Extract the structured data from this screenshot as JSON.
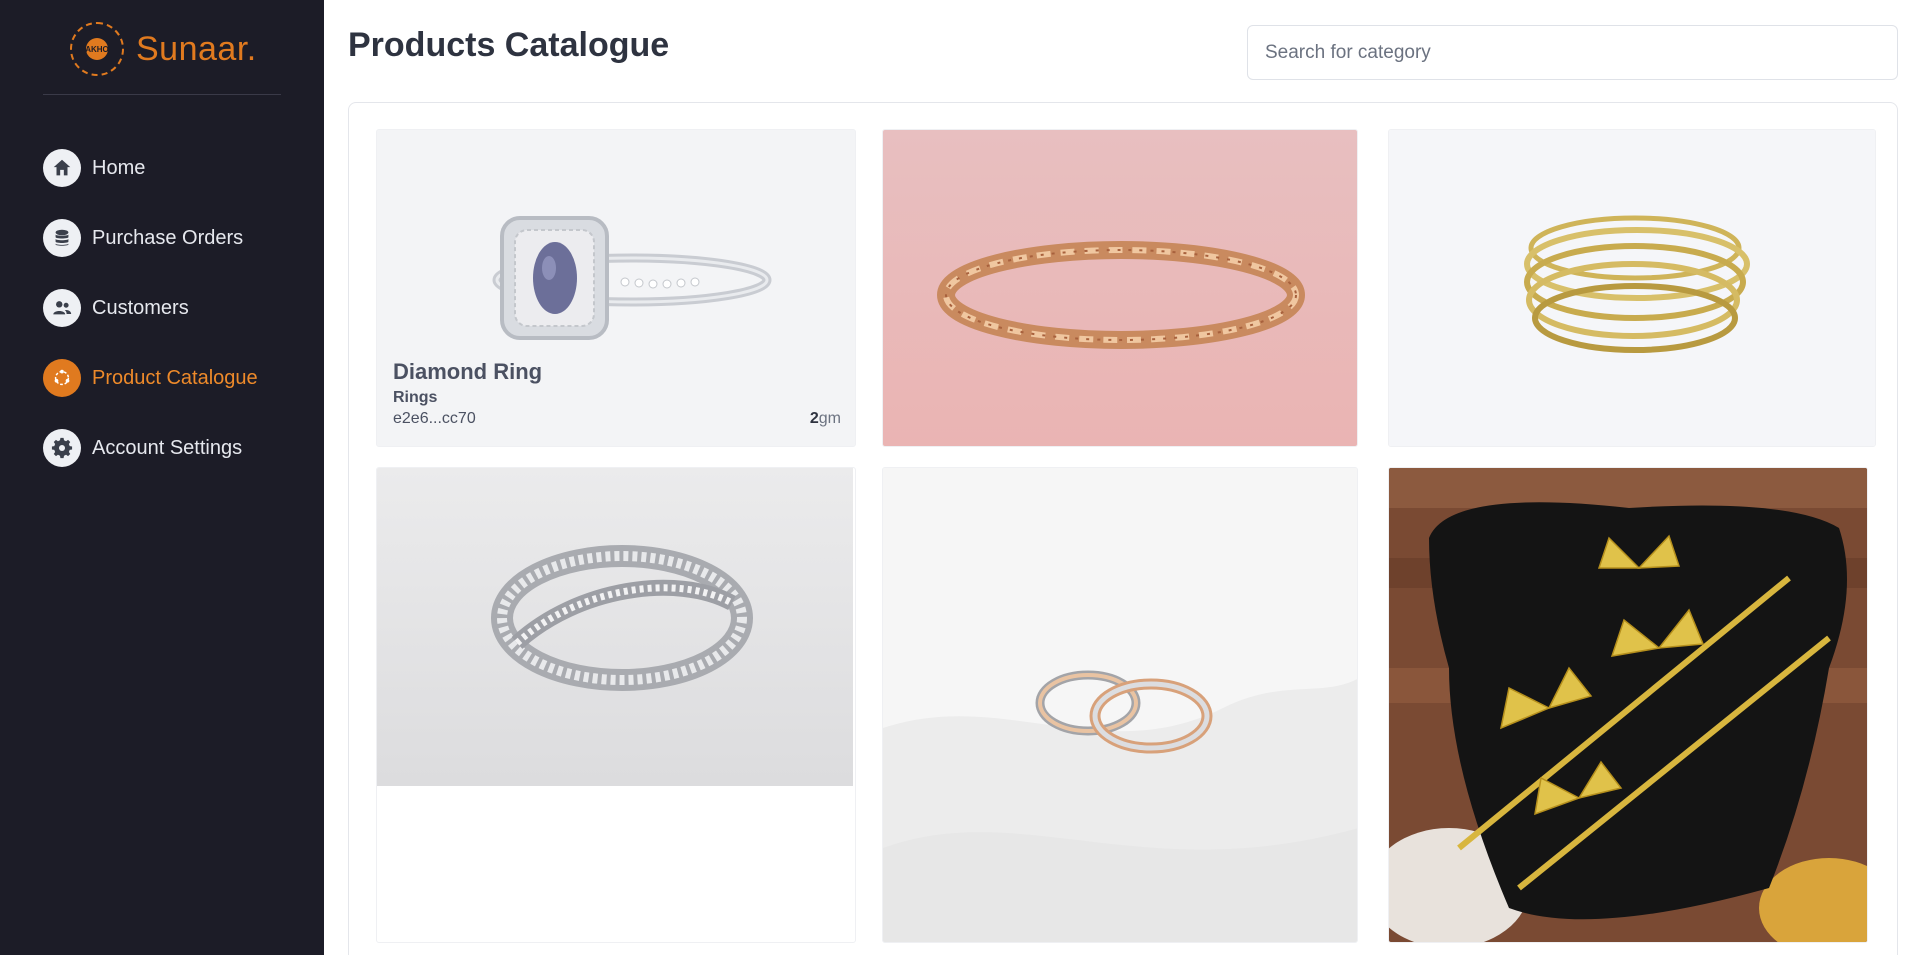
{
  "app": {
    "brand": "Sunaar.",
    "brand_mark": "AKHO",
    "accent_color": "#e07a1f",
    "sidebar_bg": "#1c1c27"
  },
  "sidebar": {
    "items": [
      {
        "label": "Home",
        "icon": "home-icon",
        "active": false
      },
      {
        "label": "Purchase Orders",
        "icon": "database-icon",
        "active": false
      },
      {
        "label": "Customers",
        "icon": "users-icon",
        "active": false
      },
      {
        "label": "Product Catalogue",
        "icon": "catalogue-icon",
        "active": true
      },
      {
        "label": "Account Settings",
        "icon": "gear-icon",
        "active": false
      }
    ]
  },
  "header": {
    "title": "Products Catalogue"
  },
  "search": {
    "placeholder": "Search for category",
    "value": ""
  },
  "products": [
    {
      "name": "Diamond Ring",
      "category": "Rings",
      "id": "e2e6...cc70",
      "weight_value": "2",
      "weight_unit": "gm",
      "image": "silver ring with blue oval sapphire and diamond halo"
    },
    {
      "image": "rose gold bracelet on pink background"
    },
    {
      "image": "stacked thin gold bangles"
    },
    {
      "image": "silver crossover diamond ring"
    },
    {
      "image": "pair of two-tone wedding bands on white fabric"
    },
    {
      "image": "gold butterfly bangles on black velvet pillow"
    }
  ]
}
